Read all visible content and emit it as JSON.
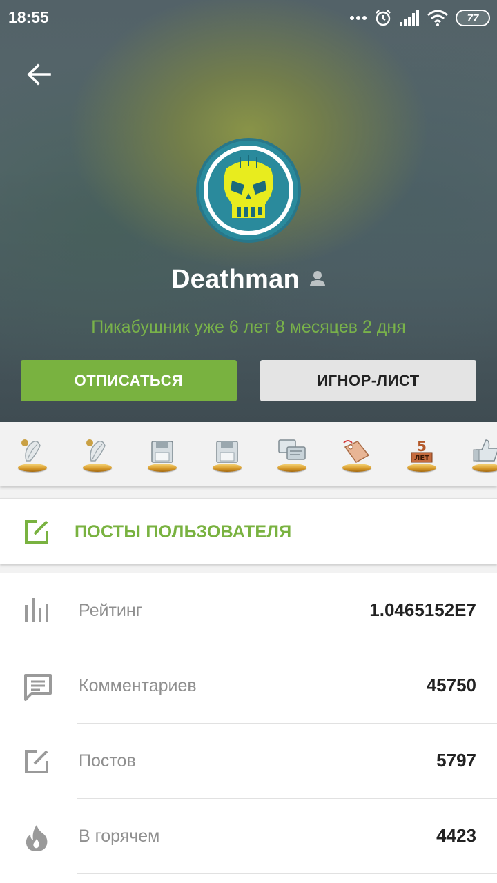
{
  "status_bar": {
    "time": "18:55",
    "battery": "77"
  },
  "profile": {
    "username": "Deathman",
    "member_since": "Пикабушник уже 6 лет 8 месяцев 2 дня"
  },
  "actions": {
    "unsubscribe_label": "ОТПИСАТЬСЯ",
    "ignore_label": "ИГНОР-ЛИСТ"
  },
  "awards": {
    "icons": [
      "award-feather-icon",
      "award-feather-icon",
      "award-floppy-icon",
      "award-floppy-icon",
      "award-chat-icon",
      "award-tag-icon",
      "award-5-years-icon",
      "award-thumbs-up-icon"
    ],
    "five_years_number": "5",
    "five_years_word": "ЛЕТ"
  },
  "posts_link": {
    "label": "ПОСТЫ ПОЛЬЗОВАТЕЛЯ"
  },
  "stats": [
    {
      "icon": "bar-chart-icon",
      "label": "Рейтинг",
      "value": "1.0465152E7"
    },
    {
      "icon": "comment-icon",
      "label": "Комментариев",
      "value": "45750"
    },
    {
      "icon": "edit-post-icon",
      "label": "Постов",
      "value": "5797"
    },
    {
      "icon": "fire-icon",
      "label": "В горячем",
      "value": "4423"
    }
  ],
  "colors": {
    "accent_green": "#79b240",
    "member_since_green": "#79b24a",
    "ignore_button": "#e4e4e4"
  }
}
